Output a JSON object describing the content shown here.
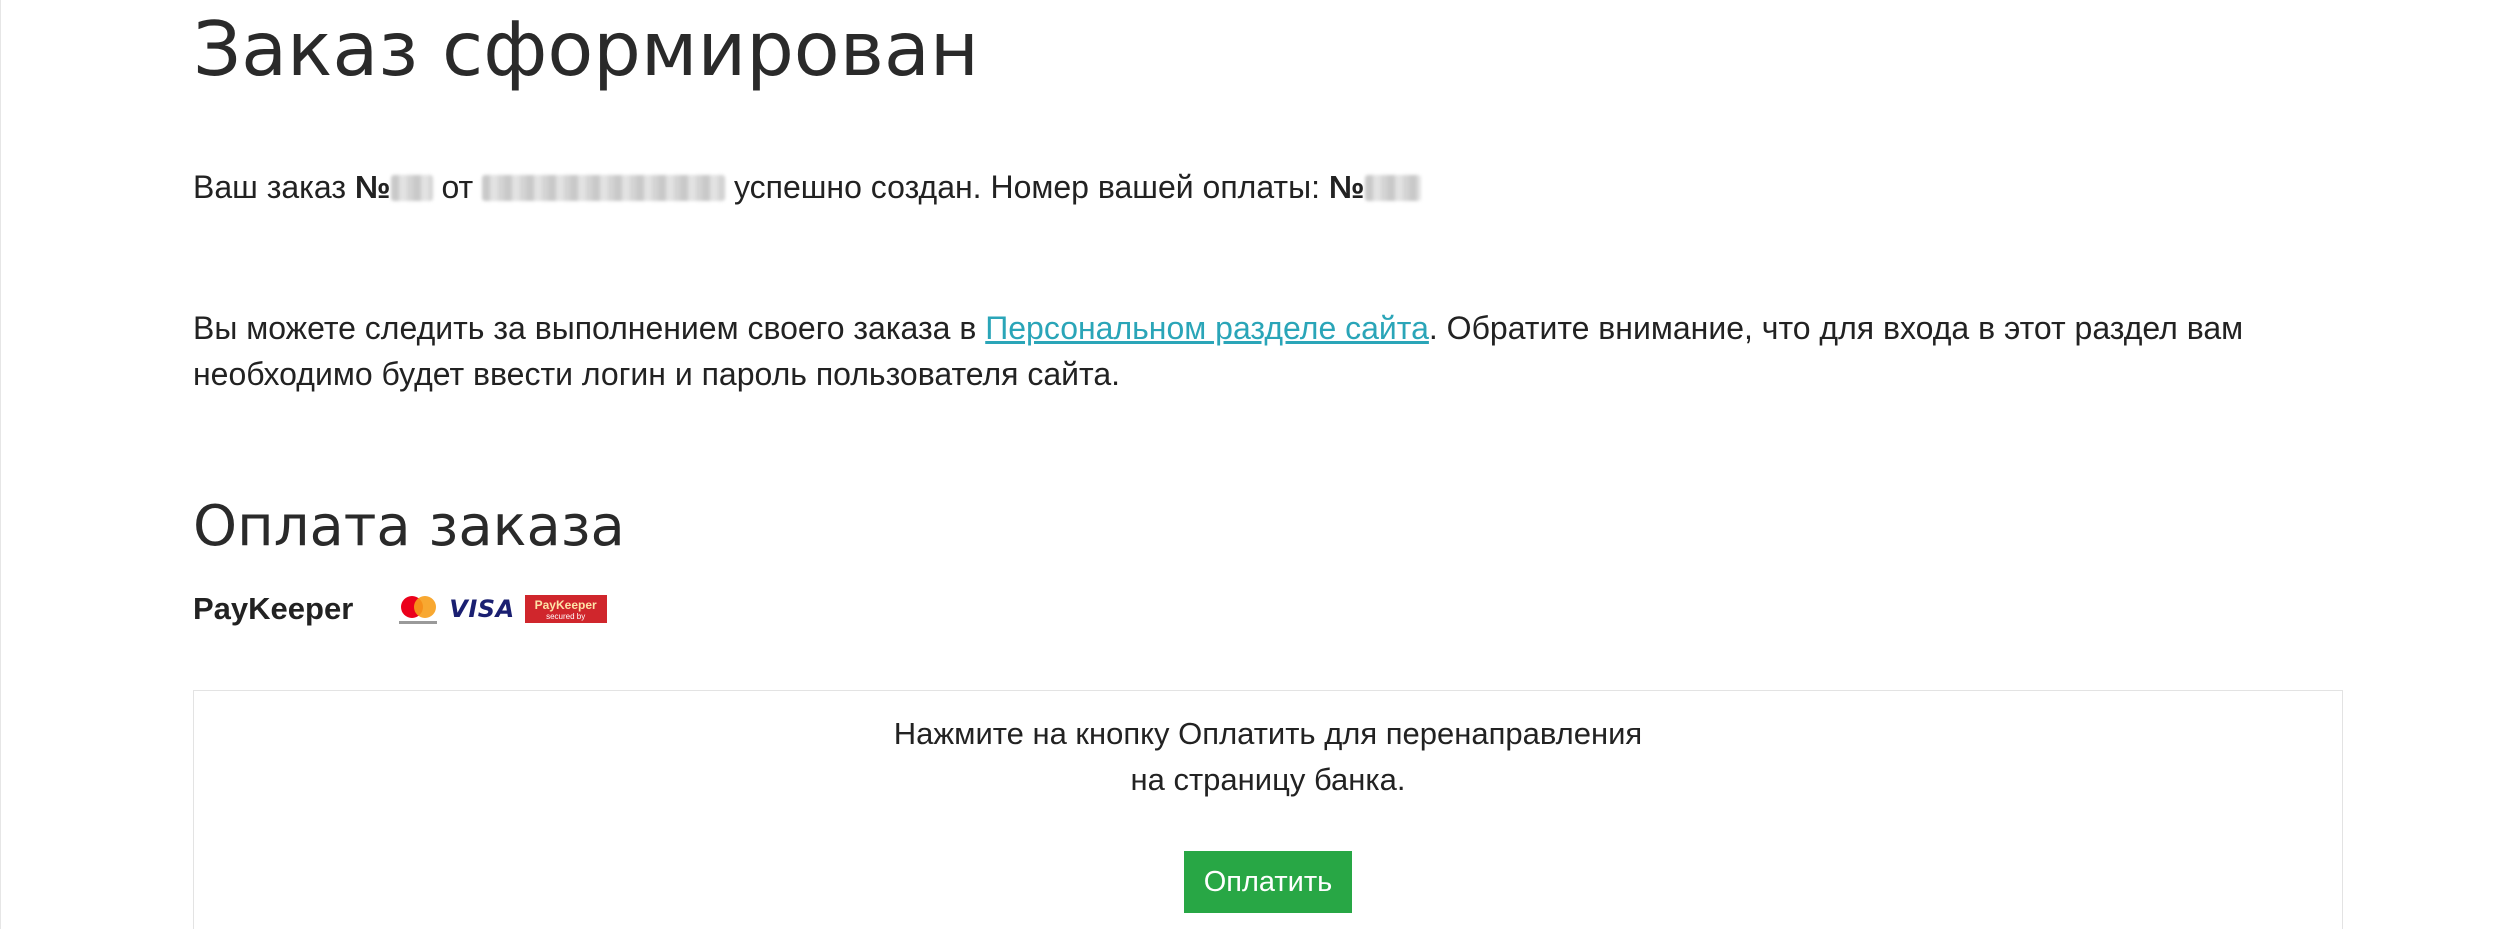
{
  "page": {
    "title": "Заказ сформирован",
    "order_line": {
      "prefix": "Ваш заказ ",
      "number_label": "№",
      "from_label": " от ",
      "suffix": " успешно создан. Номер вашей оплаты: ",
      "payment_number_label": "№"
    },
    "info": {
      "before_link": "Вы можете следить за выполнением своего заказа в ",
      "link_text": "Персональном разделе сайта",
      "after_link": ". Обратите внимание, что для входа в этот раздел вам необходимо будет ввести логин и пароль пользователя сайта."
    },
    "payment_section": {
      "title": "Оплата заказа",
      "system_name": "PayKeeper",
      "logos": {
        "mastercard": "mastercard-logo",
        "visa": "VISA",
        "paykeeper": "PayKeeper",
        "paykeeper_sub": "secured by"
      },
      "hint_line1": "Нажмите на кнопку Оплатить для перенаправления",
      "hint_line2": "на страницу банка.",
      "pay_button": "Оплатить"
    }
  },
  "colors": {
    "link": "#2aa5b8",
    "button": "#28a745",
    "text": "#222222"
  }
}
